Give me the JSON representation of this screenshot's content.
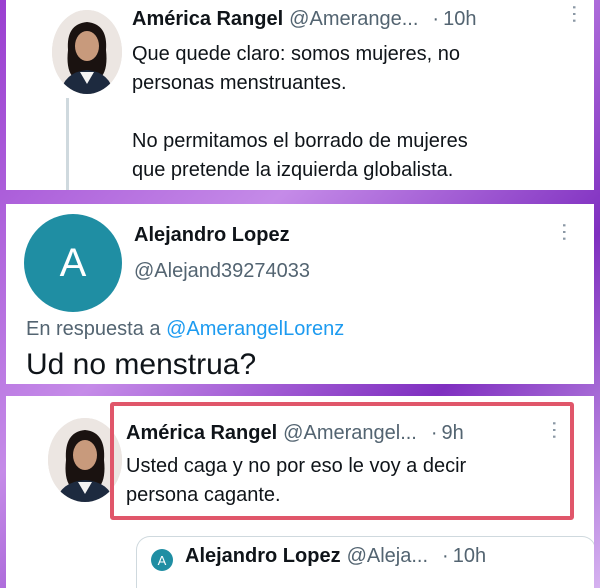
{
  "tweet1": {
    "name": "América Rangel",
    "handle": "@Amerange...",
    "dot": "·",
    "time": "10h",
    "text": "Que quede claro: somos mujeres, no\npersonas menstruantes.\n\nNo permitamos el borrado de mujeres\nque pretende la izquierda globalista."
  },
  "reply": {
    "avatar_initial": "A",
    "name": "Alejandro Lopez",
    "handle": "@Alejand39274033",
    "reply_prefix": "En respuesta a ",
    "reply_to": "@AmerangelLorenz",
    "text": "Ud no menstrua?"
  },
  "tweet2": {
    "name": "América Rangel",
    "handle": "@Amerangel...",
    "dot": "·",
    "time": "9h",
    "text": "Usted caga y no por eso le voy a decir\npersona cagante."
  },
  "quoted": {
    "avatar_initial": "A",
    "name": "Alejandro Lopez",
    "handle": "@Aleja...",
    "dot": "·",
    "time": "10h"
  },
  "more_icon": "⋯",
  "colors": {
    "link": "#1d9bf0",
    "avatar_teal": "#1f8ea3",
    "highlight_border": "#e0566a",
    "background_purple": "#9a3fd0"
  }
}
